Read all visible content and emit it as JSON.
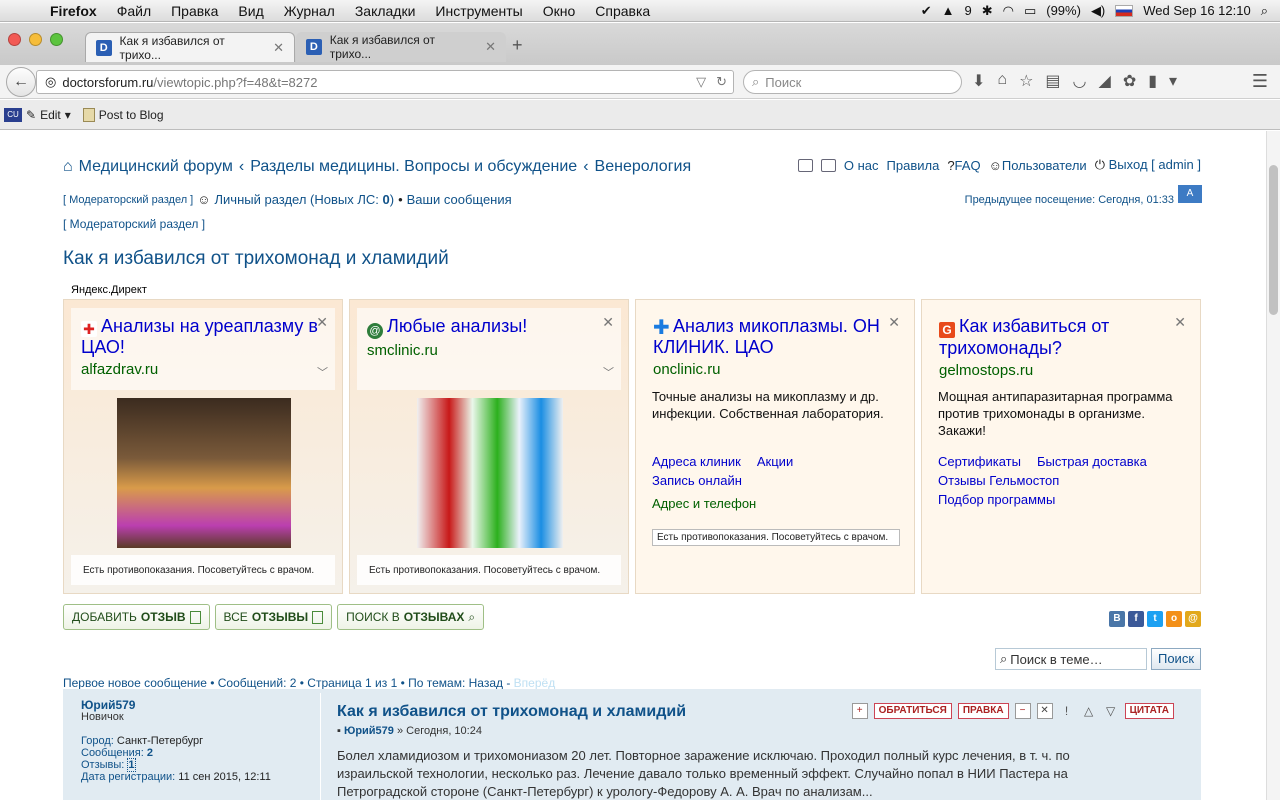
{
  "menubar": {
    "app": "Firefox",
    "items": [
      "Файл",
      "Правка",
      "Вид",
      "Журнал",
      "Закладки",
      "Инструменты",
      "Окно",
      "Справка"
    ],
    "notif": "9",
    "battery": "(99%)",
    "datetime": "Wed Sep 16  12:10"
  },
  "tabs": [
    {
      "title": "Как я избавился от трихо...",
      "icon": "D"
    },
    {
      "title": "Как я избавился от трихо...",
      "icon": "D"
    }
  ],
  "url": {
    "host": "doctorsforum.ru",
    "path": "/viewtopic.php?f=48&t=8272"
  },
  "search_placeholder": "Поиск",
  "bookmarks": [
    {
      "icon": "CU",
      "label": "Edit"
    },
    {
      "label": "Post to Blog"
    }
  ],
  "breadcrumbs": [
    "Медицинский форум",
    "Разделы медицины. Вопросы и обсуждение",
    "Венерология"
  ],
  "topnav": {
    "about": "О нас",
    "rules": "Правила",
    "faq": "FAQ",
    "users": "Пользователи",
    "logout": "Выход [ admin ]"
  },
  "userbar": {
    "mod_link": "[ Модераторский раздел ]",
    "pm_prefix": "Личный раздел (Новых ЛС: ",
    "pm_count": "0",
    "pm_suffix": ")",
    "sep": "•",
    "my_posts": "Ваши сообщения",
    "mod_link2": "[ Модераторский раздел ]",
    "last_visit": "Предыдущее посещение: Сегодня, 01:33"
  },
  "topic_title": "Как я избавился от трихомонад и хламидий",
  "ads_label": "Яндекс.Директ",
  "ads": [
    {
      "title": "Анализы на уреаплазму в ЦАО!",
      "domain": "alfazdrav.ru",
      "warn": "Есть противопоказания. Посоветуйтесь с врачом."
    },
    {
      "title": "Любые анализы!",
      "domain": "smclinic.ru",
      "warn": "Есть противопоказания. Посоветуйтесь с врачом."
    },
    {
      "title": "Анализ микоплазмы. ОН КЛИНИК. ЦАО",
      "domain": "onclinic.ru",
      "text": "Точные анализы на микоплазму и др. инфекции. Собственная лаборатория.",
      "link1": "Адреса клиник",
      "link2": "Акции",
      "link3": "Запись онлайн",
      "addr": "Адрес и телефон",
      "warn": "Есть противопоказания. Посоветуйтесь с врачом."
    },
    {
      "title": "Как избавиться от трихомонады?",
      "domain": "gelmostops.ru",
      "text": "Мощная антипаразитарная программа против трихомонады в организме. Закажи!",
      "link1": "Сертификаты",
      "link2": "Быстрая доставка",
      "link3": "Отзывы Гельмостоп",
      "link4": "Подбор программы"
    }
  ],
  "buttons": {
    "add_pre": "ДОБАВИТЬ ",
    "add_b": "ОТЗЫВ",
    "all_pre": "ВСЕ ",
    "all_b": "ОТЗЫВЫ",
    "search_pre": "ПОИСК В ",
    "search_b": "ОТЗЫВАХ"
  },
  "topic_search": {
    "placeholder": "Поиск в теме…",
    "button": "Поиск"
  },
  "pagination": {
    "text": "Первое новое сообщение • Сообщений: 2 • Страница 1 из 1 • По темам: Назад - ",
    "next": "Вперёд"
  },
  "post": {
    "author": "Юрий579",
    "rank": "Новичок",
    "city_label": "Город:",
    "city": "Санкт-Петербург",
    "posts_label": "Сообщения:",
    "posts": "2",
    "reviews_label": "Отзывы:",
    "reviews": "1",
    "reg_label": "Дата регистрации:",
    "reg": "11 сен 2015, 12:11",
    "title": "Как я избавился от трихомонад и хламидий",
    "meta_author": "Юрий579",
    "meta_date": "» Сегодня, 10:24",
    "text": "Болел хламидиозом и трихомониазом 20 лет. Повторное заражение исключаю. Проходил полный курс лечения, в т. ч. по израильской технологии, несколько раз. Лечение давало только временный эффект. Случайно попал в НИИ Пастера на Петроградской стороне (Санкт-Петербург) к урологу-Федорову А. А. Врач по анализам...",
    "tools": {
      "contact": "ОБРАТИТЬСЯ",
      "edit": "ПРАВКА",
      "quote": "ЦИТАТА"
    }
  }
}
